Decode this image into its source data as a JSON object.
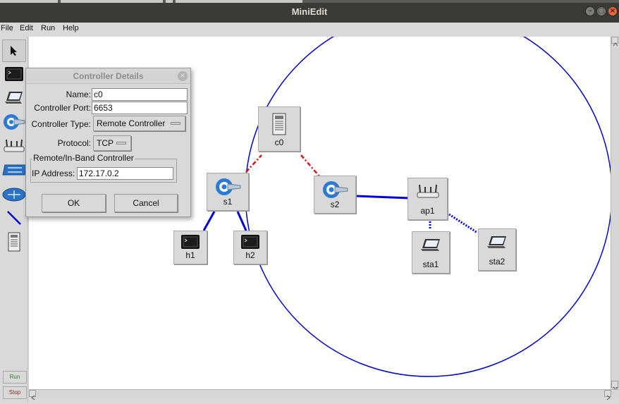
{
  "window": {
    "title": "MiniEdit"
  },
  "menu": [
    "File",
    "Edit",
    "Run",
    "Help"
  ],
  "toolbar": {
    "run_label": "Run",
    "stop_label": "Stop"
  },
  "nodes": {
    "c0": "c0",
    "s1": "s1",
    "s2": "s2",
    "ap1": "ap1",
    "h1": "h1",
    "h2": "h2",
    "sta1": "sta1",
    "sta2": "sta2"
  },
  "dialog": {
    "title": "Controller Details",
    "name_label": "Name:",
    "name_value": "c0",
    "port_label": "Controller Port:",
    "port_value": "6653",
    "type_label": "Controller Type:",
    "type_value": "Remote Controller",
    "protocol_label": "Protocol:",
    "protocol_value": "TCP",
    "group_label": "Remote/In-Band Controller",
    "ip_label": "IP Address:",
    "ip_value": "172.17.0.2",
    "ok_label": "OK",
    "cancel_label": "Cancel"
  },
  "colors": {
    "link": "#0000dd",
    "controller_link": "#dd1111",
    "range_circle": "#0000cc"
  },
  "icons": [
    "cursor-icon",
    "host-icon",
    "station-icon",
    "switch-icon",
    "access-point-icon",
    "legacy-switch-icon",
    "legacy-router-icon",
    "link-icon",
    "controller-icon"
  ]
}
